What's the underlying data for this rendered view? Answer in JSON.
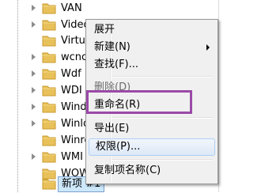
{
  "tree": {
    "items": [
      {
        "label": "VAN"
      },
      {
        "label": "Video"
      },
      {
        "label": "Virtua"
      },
      {
        "label": "wcncs"
      },
      {
        "label": "Wdf"
      },
      {
        "label": "WDI"
      },
      {
        "label": "Windo"
      },
      {
        "label": "Winlo"
      },
      {
        "label": "Winre"
      },
      {
        "label": "WMI"
      },
      {
        "label": "WOW"
      },
      {
        "label": "新项 #1"
      }
    ]
  },
  "context_menu": {
    "expand": "展开",
    "new": "新建(N)",
    "find": "查找(F)...",
    "delete": "删除(D)",
    "rename": "重命名(R)",
    "export": "导出(E)",
    "permissions": "权限(P)...",
    "copy_key_name": "复制项名称(C)"
  },
  "colors": {
    "highlight_border": "#9a4aa8",
    "folder": "#e8c15a"
  },
  "icons": {
    "folder": "folder-icon",
    "expander": "expand-arrow-icon",
    "submenu": "submenu-arrow-icon"
  }
}
